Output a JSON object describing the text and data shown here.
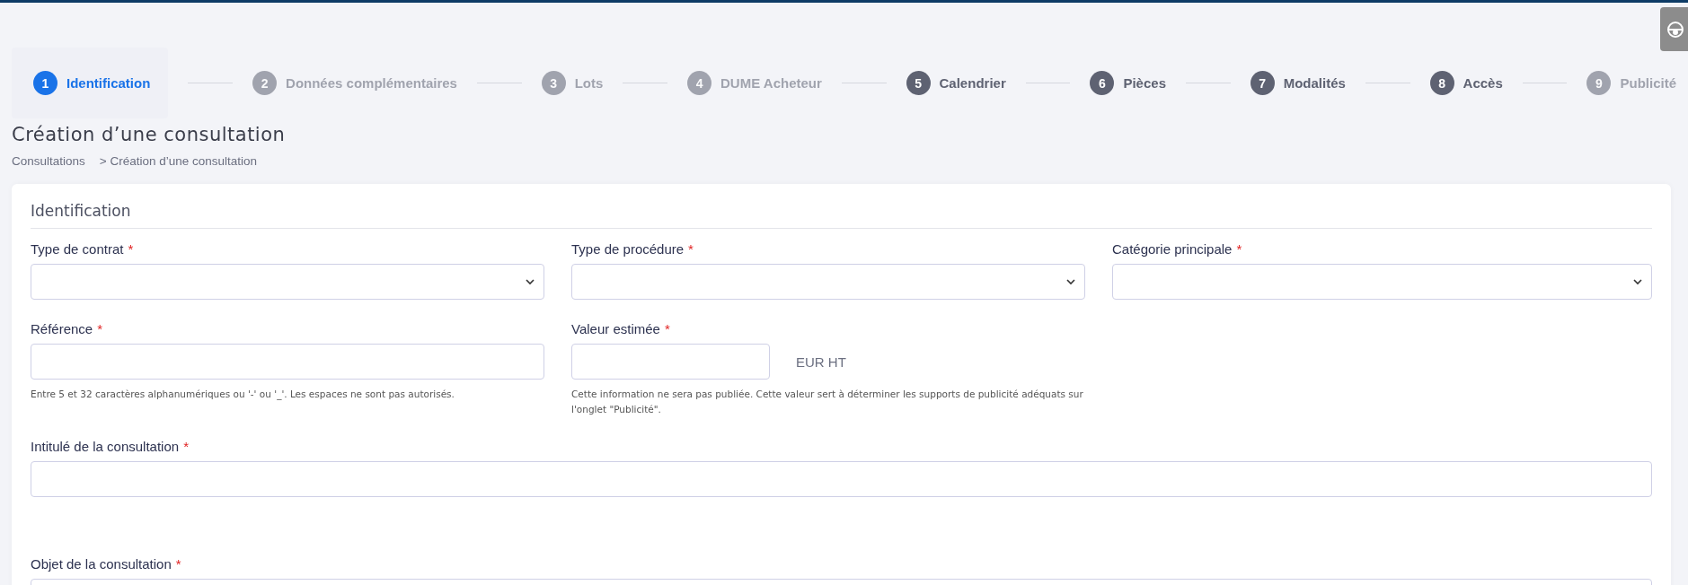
{
  "steps": [
    {
      "number": "1",
      "label": "Identification",
      "selected": true,
      "disabled": false
    },
    {
      "number": "2",
      "label": "Données complémentaires",
      "selected": false,
      "disabled": true
    },
    {
      "number": "3",
      "label": "Lots",
      "selected": false,
      "disabled": true
    },
    {
      "number": "4",
      "label": "DUME Acheteur",
      "selected": false,
      "disabled": true
    },
    {
      "number": "5",
      "label": "Calendrier",
      "selected": false,
      "disabled": false
    },
    {
      "number": "6",
      "label": "Pièces",
      "selected": false,
      "disabled": false
    },
    {
      "number": "7",
      "label": "Modalités",
      "selected": false,
      "disabled": false
    },
    {
      "number": "8",
      "label": "Accès",
      "selected": false,
      "disabled": false
    },
    {
      "number": "9",
      "label": "Publicité",
      "selected": false,
      "disabled": true
    }
  ],
  "page_title": "Création d’une consultation",
  "breadcrumb": [
    "Consultations",
    "> Création d’une consultation"
  ],
  "card": {
    "title": "Identification",
    "fields": [
      {
        "kind": "select",
        "label": "Type de contrat",
        "required": true
      },
      {
        "kind": "select",
        "label": "Type de procédure",
        "required": true
      },
      {
        "kind": "select",
        "label": "Catégorie principale",
        "required": true
      },
      {
        "kind": "text",
        "label": "Référence",
        "required": true,
        "hint": "Entre 5 et 32 caractères alphanumériques ou '-' ou '_'. Les espaces ne sont pas autorisés."
      },
      {
        "kind": "amount",
        "label": "Valeur estimée",
        "required": true,
        "unit": "EUR HT",
        "hint": "Cette information ne sera pas publiée. Cette valeur sert à déterminer les supports de publicité adéquats sur l'onglet \"Publicité\"."
      },
      {
        "kind": "wide",
        "label": "Intitulé de la consultation",
        "required": true
      },
      {
        "kind": "wide",
        "label": "Objet de la consultation",
        "required": true
      }
    ]
  },
  "required_mark": "*"
}
